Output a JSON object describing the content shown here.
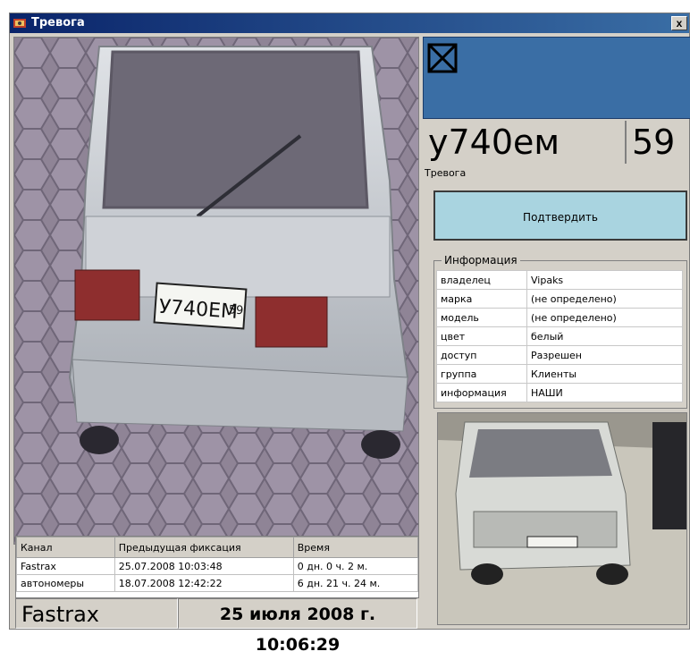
{
  "window": {
    "title": "Тревога",
    "close_label": "x"
  },
  "photo": {
    "plate_text": "У740ЕМ",
    "plate_region": "59"
  },
  "events": {
    "columns": [
      "Канал",
      "Предыдущая фиксация",
      "Время"
    ],
    "rows": [
      [
        "Fastrax",
        "25.07.2008 10:03:48",
        "0 дн. 0 ч. 2 м."
      ],
      [
        "автономеры",
        "18.07.2008 12:42:22",
        "6 дн. 21 ч. 24 м."
      ]
    ]
  },
  "status": {
    "channel": "Fastrax",
    "datetime": "25 июля 2008 г. 10:06:29"
  },
  "alarm": {
    "plate": "у740ем",
    "region": "59",
    "label": "Тревога",
    "confirm_label": "Подтвердить",
    "icon": "crossed-box-icon"
  },
  "info": {
    "legend": "Информация",
    "rows": [
      [
        "владелец",
        "Vipaks"
      ],
      [
        "марка",
        "(не определено)"
      ],
      [
        "модель",
        "(не определено)"
      ],
      [
        "цвет",
        "белый"
      ],
      [
        "доступ",
        "Разрешен"
      ],
      [
        "группа",
        "Клиенты"
      ],
      [
        "информация",
        "НАШИ"
      ]
    ]
  },
  "colors": {
    "titlebar": "#0a246a",
    "alarm_panel": "#3a6ea5",
    "confirm_button": "#a9d4e0",
    "window_bg": "#d4d0c8"
  }
}
